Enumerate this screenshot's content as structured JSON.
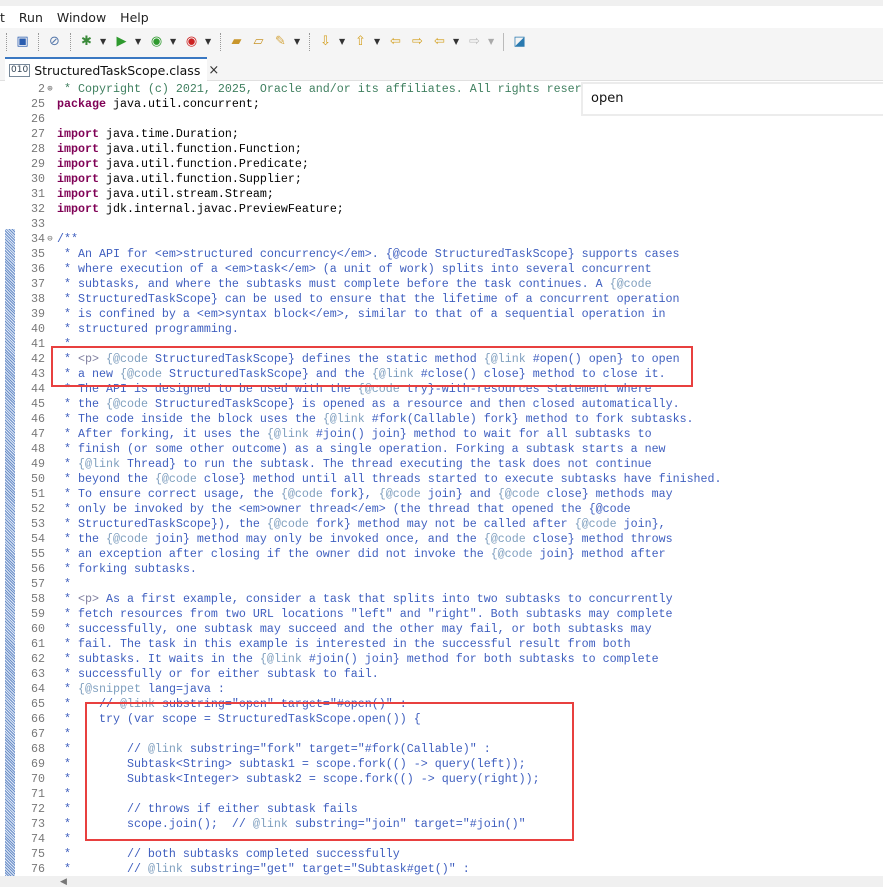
{
  "menu": [
    "t",
    "Run",
    "Window",
    "Help"
  ],
  "toolbar": {
    "icons": [
      "display-icon",
      "skip-breakpoints-icon",
      "debug-icon",
      "run-icon",
      "run-coverage-icon",
      "external-tools-icon",
      "open-type-icon",
      "open-task-icon",
      "search-icon",
      "next-annotation-icon",
      "previous-annotation-icon",
      "last-edit-icon",
      "next-edit-icon",
      "back-icon",
      "forward-icon",
      "new-window-icon"
    ]
  },
  "tab": {
    "label": "StructuredTaskScope.class",
    "close": "×"
  },
  "find": {
    "value": "open"
  },
  "lines": [
    {
      "n": "2",
      "fold": "⊕",
      "kind": "comment",
      "text": " * Copyright (c) 2021, 2025, Oracle and/or its affiliates. All rights reser"
    },
    {
      "n": "25",
      "kind": "code",
      "text": "package java.util.concurrent;"
    },
    {
      "n": "26",
      "kind": "code",
      "text": ""
    },
    {
      "n": "27",
      "kind": "code",
      "text": "import java.time.Duration;"
    },
    {
      "n": "28",
      "kind": "code",
      "text": "import java.util.function.Function;"
    },
    {
      "n": "29",
      "kind": "code",
      "text": "import java.util.function.Predicate;"
    },
    {
      "n": "30",
      "kind": "code",
      "text": "import java.util.function.Supplier;"
    },
    {
      "n": "31",
      "kind": "code",
      "text": "import java.util.stream.Stream;"
    },
    {
      "n": "32",
      "kind": "code",
      "text": "import jdk.internal.javac.PreviewFeature;"
    },
    {
      "n": "33",
      "kind": "code",
      "text": ""
    },
    {
      "n": "34",
      "fold": "⊖",
      "kind": "javadoc",
      "text": "/**"
    },
    {
      "n": "35",
      "kind": "javadoc",
      "text": " * An API for <em>structured concurrency</em>. {@code StructuredTaskScope} supports cases"
    },
    {
      "n": "36",
      "kind": "javadoc",
      "text": " * where execution of a <em>task</em> (a unit of work) splits into several concurrent"
    },
    {
      "n": "37",
      "kind": "javadoc",
      "text": " * subtasks, and where the subtasks must complete before the task continues. A {@code"
    },
    {
      "n": "38",
      "kind": "javadoc",
      "text": " * StructuredTaskScope} can be used to ensure that the lifetime of a concurrent operation"
    },
    {
      "n": "39",
      "kind": "javadoc",
      "text": " * is confined by a <em>syntax block</em>, similar to that of a sequential operation in"
    },
    {
      "n": "40",
      "kind": "javadoc",
      "text": " * structured programming."
    },
    {
      "n": "41",
      "kind": "javadoc",
      "text": " *"
    },
    {
      "n": "42",
      "kind": "javadoc",
      "text": " * <p> {@code StructuredTaskScope} defines the static method {@link #open() open} to open"
    },
    {
      "n": "43",
      "kind": "javadoc",
      "text": " * a new {@code StructuredTaskScope} and the {@link #close() close} method to close it."
    },
    {
      "n": "44",
      "kind": "javadoc",
      "text": " * The API is designed to be used with the {@code try}-with-resources statement where"
    },
    {
      "n": "45",
      "kind": "javadoc",
      "text": " * the {@code StructuredTaskScope} is opened as a resource and then closed automatically."
    },
    {
      "n": "46",
      "kind": "javadoc",
      "text": " * The code inside the block uses the {@link #fork(Callable) fork} method to fork subtasks."
    },
    {
      "n": "47",
      "kind": "javadoc",
      "text": " * After forking, it uses the {@link #join() join} method to wait for all subtasks to"
    },
    {
      "n": "48",
      "kind": "javadoc",
      "text": " * finish (or some other outcome) as a single operation. Forking a subtask starts a new"
    },
    {
      "n": "49",
      "kind": "javadoc",
      "text": " * {@link Thread} to run the subtask. The thread executing the task does not continue"
    },
    {
      "n": "50",
      "kind": "javadoc",
      "text": " * beyond the {@code close} method until all threads started to execute subtasks have finished."
    },
    {
      "n": "51",
      "kind": "javadoc",
      "text": " * To ensure correct usage, the {@code fork}, {@code join} and {@code close} methods may"
    },
    {
      "n": "52",
      "kind": "javadoc",
      "text": " * only be invoked by the <em>owner thread</em> (the thread that opened the {@code"
    },
    {
      "n": "53",
      "kind": "javadoc",
      "text": " * StructuredTaskScope}), the {@code fork} method may not be called after {@code join},"
    },
    {
      "n": "54",
      "kind": "javadoc",
      "text": " * the {@code join} method may only be invoked once, and the {@code close} method throws"
    },
    {
      "n": "55",
      "kind": "javadoc",
      "text": " * an exception after closing if the owner did not invoke the {@code join} method after"
    },
    {
      "n": "56",
      "kind": "javadoc",
      "text": " * forking subtasks."
    },
    {
      "n": "57",
      "kind": "javadoc",
      "text": " *"
    },
    {
      "n": "58",
      "kind": "javadoc",
      "text": " * <p> As a first example, consider a task that splits into two subtasks to concurrently"
    },
    {
      "n": "59",
      "kind": "javadoc",
      "text": " * fetch resources from two URL locations \"left\" and \"right\". Both subtasks may complete"
    },
    {
      "n": "60",
      "kind": "javadoc",
      "text": " * successfully, one subtask may succeed and the other may fail, or both subtasks may"
    },
    {
      "n": "61",
      "kind": "javadoc",
      "text": " * fail. The task in this example is interested in the successful result from both"
    },
    {
      "n": "62",
      "kind": "javadoc",
      "text": " * subtasks. It waits in the {@link #join() join} method for both subtasks to complete"
    },
    {
      "n": "63",
      "kind": "javadoc",
      "text": " * successfully or for either subtask to fail."
    },
    {
      "n": "64",
      "kind": "javadoc",
      "text": " * {@snippet lang=java :"
    },
    {
      "n": "65",
      "kind": "javadoc",
      "text": " *    // @link substring=\"open\" target=\"#open()\" :"
    },
    {
      "n": "66",
      "kind": "javadoc",
      "text": " *    try (var scope = StructuredTaskScope.open()) {"
    },
    {
      "n": "67",
      "kind": "javadoc",
      "text": " *"
    },
    {
      "n": "68",
      "kind": "javadoc",
      "text": " *        // @link substring=\"fork\" target=\"#fork(Callable)\" :"
    },
    {
      "n": "69",
      "kind": "javadoc",
      "text": " *        Subtask<String> subtask1 = scope.fork(() -> query(left));"
    },
    {
      "n": "70",
      "kind": "javadoc",
      "text": " *        Subtask<Integer> subtask2 = scope.fork(() -> query(right));"
    },
    {
      "n": "71",
      "kind": "javadoc",
      "text": " *"
    },
    {
      "n": "72",
      "kind": "javadoc",
      "text": " *        // throws if either subtask fails"
    },
    {
      "n": "73",
      "kind": "javadoc",
      "text": " *        scope.join();  // @link substring=\"join\" target=\"#join()\""
    },
    {
      "n": "74",
      "kind": "javadoc",
      "text": " *"
    },
    {
      "n": "75",
      "kind": "javadoc",
      "text": " *        // both subtasks completed successfully"
    },
    {
      "n": "76",
      "kind": "javadoc",
      "text": " *        // @link substring=\"get\" target=\"Subtask#get()\" :"
    }
  ],
  "colors": {
    "keyword": "#7f0055",
    "comment": "#3f7f5f",
    "javadoc": "#3f5fbf",
    "highlight_box": "#e8403f",
    "tab_accent": "#3a78c2"
  }
}
